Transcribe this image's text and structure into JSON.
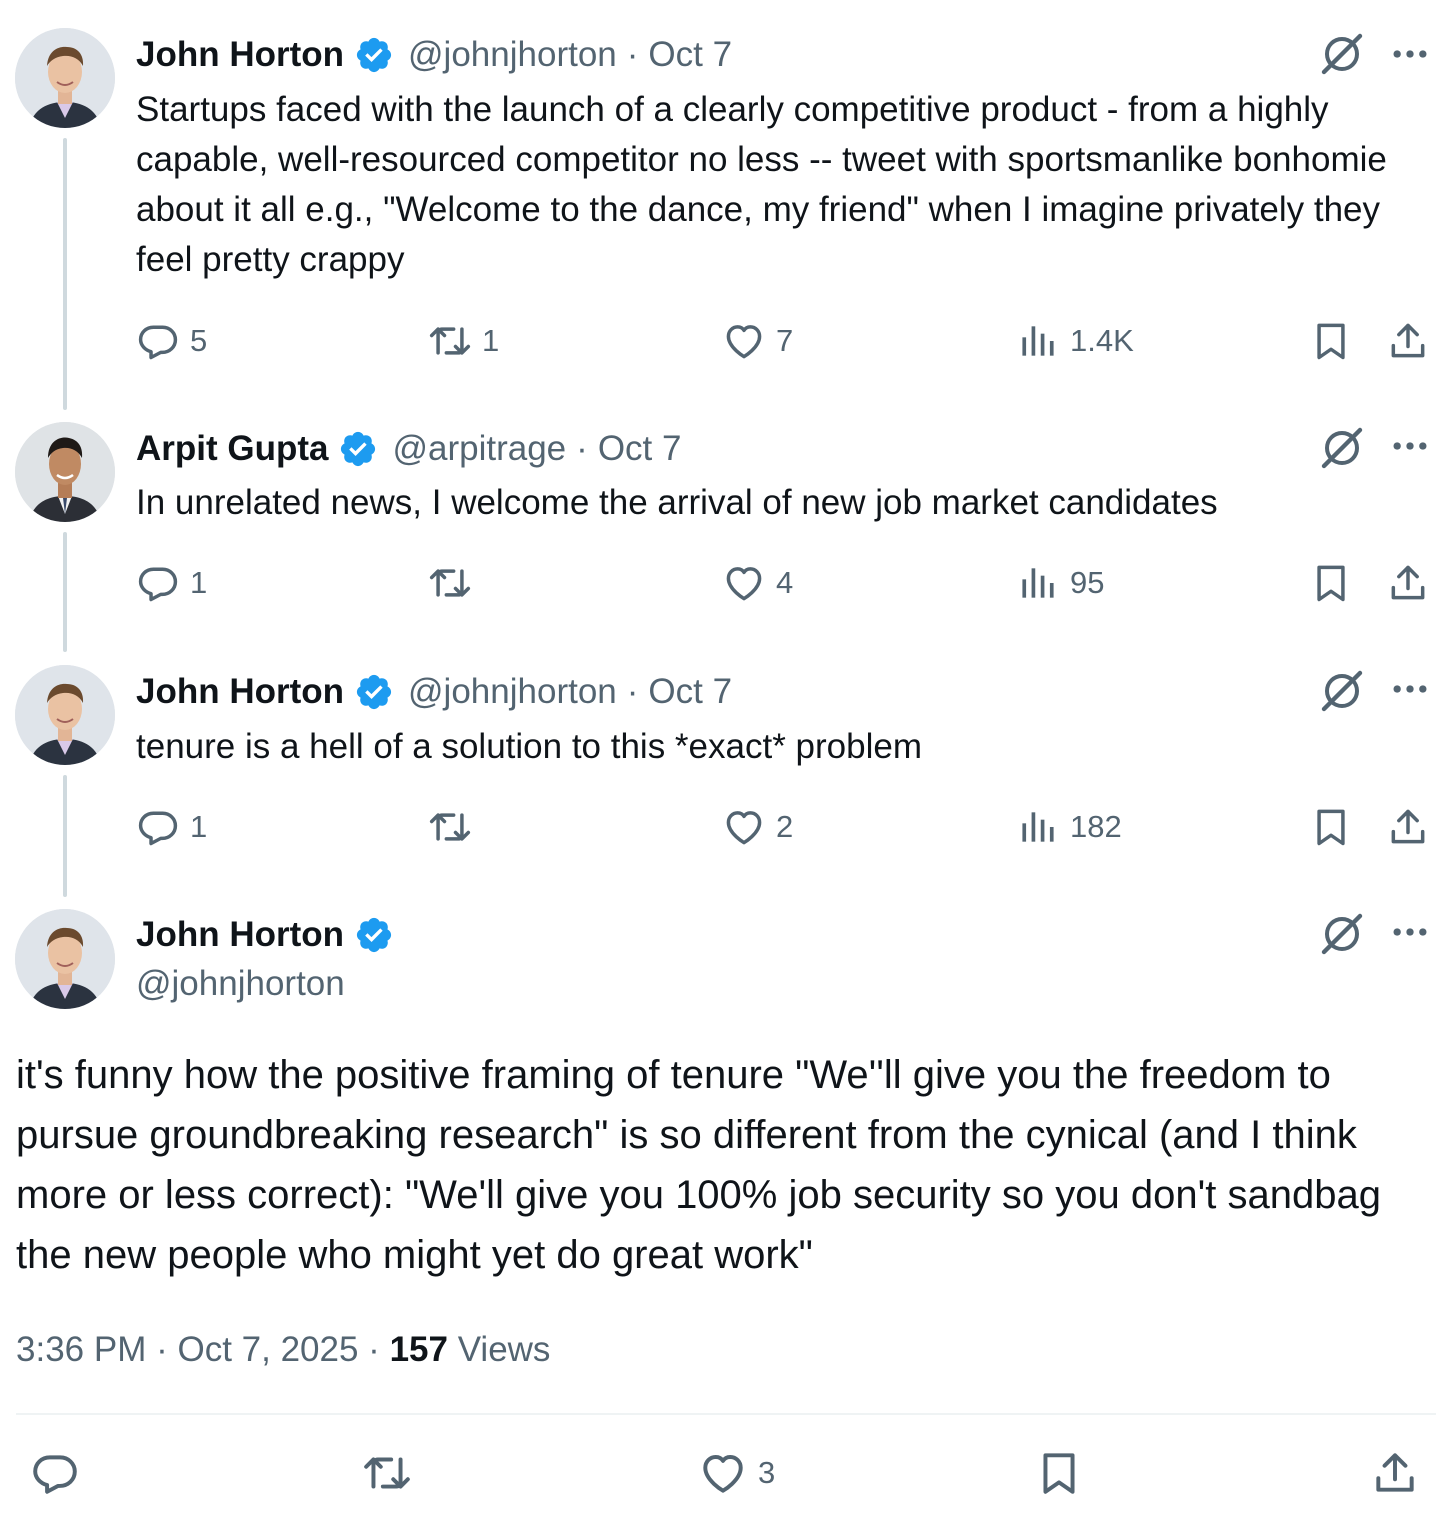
{
  "thread": [
    {
      "name": "John Horton",
      "handle": "@johnjhorton",
      "sep": "·",
      "date": "Oct 7",
      "text": "Startups faced with the launch of a clearly competitive product - from a highly capable, well-resourced competitor no less -- tweet with sportsmanlike bonhomie about it all  e.g., \"Welcome to the dance, my friend\" when I imagine privately they feel pretty crappy",
      "replies": "5",
      "reposts": "1",
      "likes": "7",
      "views": "1.4K"
    },
    {
      "name": "Arpit Gupta",
      "handle": "@arpitrage",
      "sep": "·",
      "date": "Oct 7",
      "text": "In unrelated news, I welcome the arrival of new job market candidates",
      "replies": "1",
      "reposts": "",
      "likes": "4",
      "views": "95"
    },
    {
      "name": "John Horton",
      "handle": "@johnjhorton",
      "sep": "·",
      "date": "Oct 7",
      "text": "tenure is a hell of a solution to this *exact* problem",
      "replies": "1",
      "reposts": "",
      "likes": "2",
      "views": "182"
    }
  ],
  "main": {
    "name": "John Horton",
    "handle": "@johnjhorton",
    "text": "it's funny how the positive framing of tenure \"We''ll give you the freedom to pursue groundbreaking research\" is so different from the cynical (and I think more or less correct): \"We'll give you 100% job security so you don't sandbag the new people who might yet do great work\"",
    "time": "3:36 PM",
    "date": "Oct 7, 2025",
    "sep": "·",
    "views_count": "157",
    "views_label": "Views",
    "replies": "",
    "reposts": "",
    "likes": "3"
  },
  "colors": {
    "text": "#0f1419",
    "secondary": "#536471",
    "verified": "#1d9bf0",
    "thread_line": "#cfd9de",
    "divider": "#eff3f4"
  },
  "icons": [
    "verified-badge-icon",
    "grok-icon",
    "more-icon",
    "reply-icon",
    "repost-icon",
    "like-icon",
    "views-icon",
    "bookmark-icon",
    "share-icon"
  ]
}
